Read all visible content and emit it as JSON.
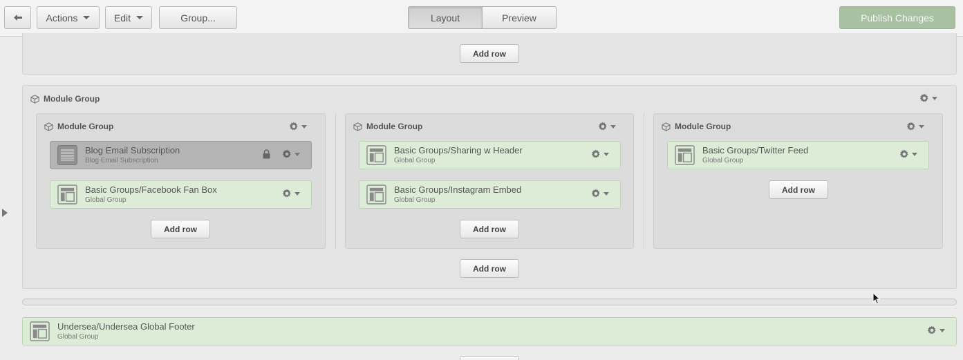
{
  "toolbar": {
    "back_icon": "undo-arrow-icon",
    "actions_label": "Actions",
    "edit_label": "Edit",
    "group_label": "Group...",
    "tab_layout": "Layout",
    "tab_preview": "Preview",
    "active_tab": "Layout",
    "publish_label": "Publish Changes",
    "publish_color": "#a9c1a3"
  },
  "top_panel": {
    "add_row_label": "Add row"
  },
  "outer_group": {
    "title": "Module Group",
    "add_row_label": "Add row",
    "columns": [
      {
        "title": "Module Group",
        "modules": [
          {
            "title": "Blog Email Subscription",
            "subtitle": "Blog Email Subscription",
            "locked": true
          },
          {
            "title": "Basic Groups/Facebook Fan Box",
            "subtitle": "Global Group",
            "locked": false
          }
        ],
        "add_row_label": "Add row"
      },
      {
        "title": "Module Group",
        "modules": [
          {
            "title": "Basic Groups/Sharing w Header",
            "subtitle": "Global Group",
            "locked": false
          },
          {
            "title": "Basic Groups/Instagram Embed",
            "subtitle": "Global Group",
            "locked": false
          }
        ],
        "add_row_label": "Add row"
      },
      {
        "title": "Module Group",
        "modules": [
          {
            "title": "Basic Groups/Twitter Feed",
            "subtitle": "Global Group",
            "locked": false
          }
        ],
        "add_row_label": "Add row"
      }
    ]
  },
  "footer_module": {
    "title": "Undersea/Undersea Global Footer",
    "subtitle": "Global Group"
  },
  "colors": {
    "module_green": "#dcecd6",
    "locked_gray": "#b4b4b4",
    "panel_gray": "#e4e4e4"
  }
}
